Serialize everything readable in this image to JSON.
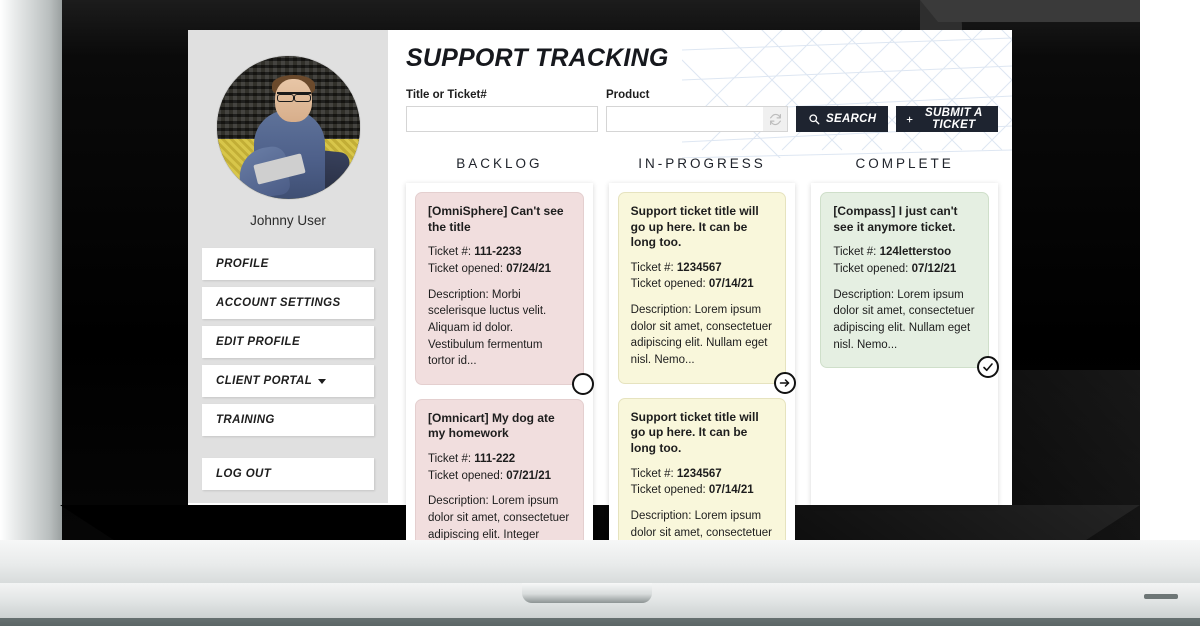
{
  "header": {
    "title": "SUPPORT TRACKING"
  },
  "search": {
    "title_label": "Title or Ticket#",
    "title_value": "",
    "title_placeholder": "",
    "product_label": "Product",
    "product_value": "",
    "product_placeholder": "",
    "refresh_icon": "refresh-icon",
    "search_button": "SEARCH",
    "search_icon": "search-icon",
    "submit_button": "SUBMIT A TICKET",
    "submit_icon": "plus-icon"
  },
  "sidebar": {
    "user_name": "Johnny User",
    "avatar_icon": "avatar",
    "items": [
      {
        "label": "PROFILE",
        "has_caret": false
      },
      {
        "label": "ACCOUNT SETTINGS",
        "has_caret": false
      },
      {
        "label": "EDIT PROFILE",
        "has_caret": false
      },
      {
        "label": "CLIENT PORTAL",
        "has_caret": true
      },
      {
        "label": "TRAINING",
        "has_caret": false
      },
      {
        "label": "LOG OUT",
        "has_caret": false
      }
    ]
  },
  "board": {
    "columns": [
      {
        "title": "BACKLOG",
        "status_icon": "circle-empty-icon",
        "cards": [
          {
            "title": "[OmniSphere] Can't see the title",
            "ticket_label": "Ticket #:",
            "ticket_number": "111-2233",
            "opened_label": "Ticket opened:",
            "opened_date": "07/24/21",
            "description": "Description: Morbi scelerisque luctus velit. Aliquam id dolor. Vestibulum fermentum tortor id..."
          },
          {
            "title": "[Omnicart] My dog ate my homework",
            "ticket_label": "Ticket #:",
            "ticket_number": "111-222",
            "opened_label": "Ticket opened:",
            "opened_date": "07/21/21",
            "description": "Description: Lorem ipsum dolor sit amet, consectetuer adipiscing elit. Integer tempor. Nullam..."
          }
        ]
      },
      {
        "title": "IN-PROGRESS",
        "status_icon": "arrow-right-icon",
        "cards": [
          {
            "title": "Support ticket title will go up here. It can be long too.",
            "ticket_label": "Ticket #:",
            "ticket_number": "1234567",
            "opened_label": "Ticket opened:",
            "opened_date": "07/14/21",
            "description": "Description: Lorem ipsum dolor sit amet, consectetuer adipiscing elit. Nullam eget nisl. Nemo..."
          },
          {
            "title": "Support ticket title will go up here. It can be long too.",
            "ticket_label": "Ticket #:",
            "ticket_number": "1234567",
            "opened_label": "Ticket opened:",
            "opened_date": "07/14/21",
            "description": "Description: Lorem ipsum dolor sit amet, consectetuer adipiscing elit. Nullam eget nisl. Nemo..."
          }
        ]
      },
      {
        "title": "COMPLETE",
        "status_icon": "check-circle-icon",
        "cards": [
          {
            "title": "[Compass] I just can't see it anymore ticket.",
            "ticket_label": "Ticket #:",
            "ticket_number": "124letterstoo",
            "opened_label": "Ticket opened:",
            "opened_date": "07/12/21",
            "description": "Description: Lorem ipsum dolor sit amet, consectetuer adipiscing elit. Nullam eget nisl. Nemo..."
          }
        ]
      }
    ]
  },
  "colors": {
    "sidebar_bg": "#e0e0e0",
    "button_dark": "#1e2430",
    "card_backlog": "#f1dede",
    "card_progress": "#f9f7db",
    "card_complete": "#e5efe2",
    "pattern_line": "#c3d3e8"
  }
}
